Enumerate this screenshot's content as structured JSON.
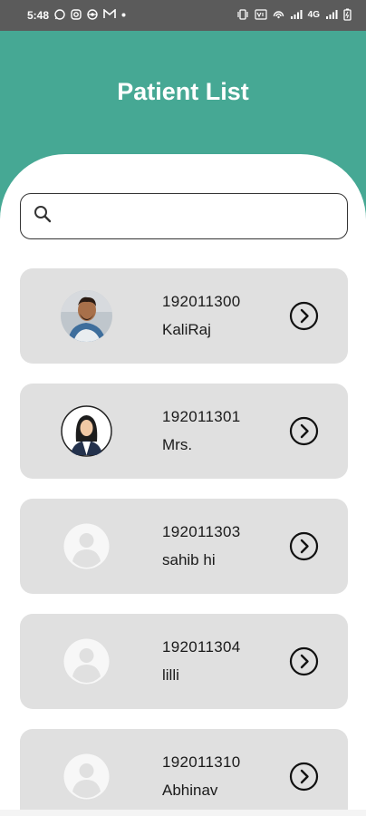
{
  "status_bar": {
    "time": "5:48",
    "network_label": "4G",
    "left_icons": [
      "whatsapp-icon",
      "instagram-icon",
      "chrome-icon",
      "gmail-icon",
      "dot-icon"
    ],
    "right_icons": [
      "vibrate-icon",
      "volte-icon",
      "hotspot-icon",
      "signal-icon",
      "battery-icon"
    ]
  },
  "header": {
    "title": "Patient List",
    "background_color": "#46a894"
  },
  "search": {
    "placeholder": "",
    "value": ""
  },
  "patients": [
    {
      "id": "192011300",
      "name": "KaliRaj",
      "avatar": "photo-man"
    },
    {
      "id": "192011301",
      "name": "Mrs.",
      "avatar": "illustration-woman"
    },
    {
      "id": "192011303",
      "name": "sahib hi",
      "avatar": "default-user"
    },
    {
      "id": "192011304",
      "name": "lilli",
      "avatar": "default-user"
    },
    {
      "id": "192011310",
      "name": "Abhinav",
      "avatar": "default-user"
    }
  ],
  "colors": {
    "accent": "#46a894",
    "card": "#e0e0e0",
    "status_bar": "#5b5b5b"
  }
}
